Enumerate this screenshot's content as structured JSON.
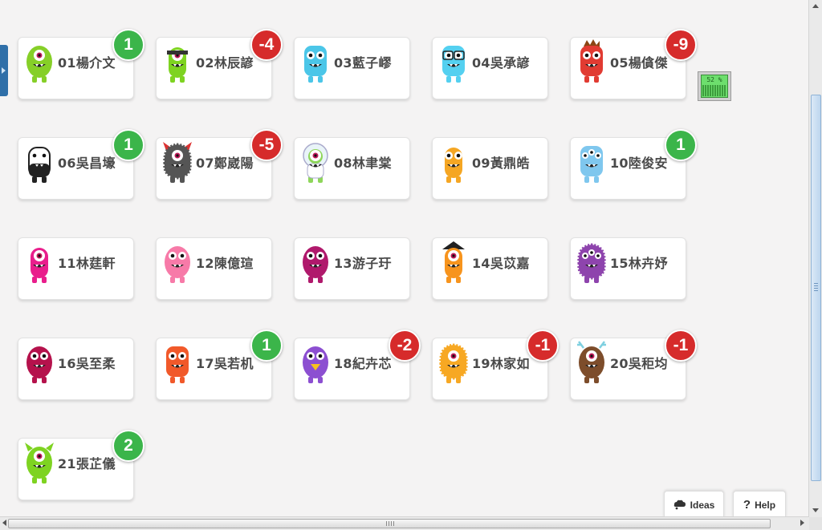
{
  "students": [
    {
      "name": "01楊介文",
      "points": "1",
      "sign": "pos",
      "monster": {
        "type": "round",
        "color": "#86cf28",
        "eyes": 1
      }
    },
    {
      "name": "02林辰諺",
      "points": "-4",
      "sign": "neg",
      "monster": {
        "type": "slim",
        "color": "#7ed321",
        "eyes": 1,
        "band": "#333"
      }
    },
    {
      "name": "03藍子嵺",
      "points": "",
      "sign": "none",
      "monster": {
        "type": "tall",
        "color": "#4bc6e8",
        "eyes": 2
      }
    },
    {
      "name": "04吳承諺",
      "points": "",
      "sign": "none",
      "monster": {
        "type": "tall",
        "color": "#54d0f0",
        "eyes": 2,
        "glasses": true
      }
    },
    {
      "name": "05楊僋傑",
      "points": "-9",
      "sign": "neg",
      "monster": {
        "type": "tall",
        "color": "#e13b32",
        "eyes": 2,
        "hair": "#8b4513"
      }
    },
    {
      "name": "06吳昌壕",
      "points": "1",
      "sign": "pos",
      "monster": {
        "type": "panda",
        "color": "#222",
        "eyes": 2
      }
    },
    {
      "name": "07鄭崴陽",
      "points": "-5",
      "sign": "neg",
      "monster": {
        "type": "furry",
        "color": "#555",
        "eyes": 1,
        "horns": "#d33"
      }
    },
    {
      "name": "08林聿棠",
      "points": "",
      "sign": "none",
      "monster": {
        "type": "astro",
        "color": "#8ed65a",
        "eyes": 1
      }
    },
    {
      "name": "09黃鼎皓",
      "points": "",
      "sign": "none",
      "monster": {
        "type": "slim",
        "color": "#f5a623",
        "eyes": 2
      }
    },
    {
      "name": "10陸俊安",
      "points": "1",
      "sign": "pos",
      "monster": {
        "type": "tall",
        "color": "#7fc7ee",
        "eyes": 3
      }
    },
    {
      "name": "11林莛軒",
      "points": "",
      "sign": "none",
      "monster": {
        "type": "slim",
        "color": "#e91e8c",
        "eyes": 1
      }
    },
    {
      "name": "12陳億瑄",
      "points": "",
      "sign": "none",
      "monster": {
        "type": "round",
        "color": "#f77aa8",
        "eyes": 2
      }
    },
    {
      "name": "13游子玗",
      "points": "",
      "sign": "none",
      "monster": {
        "type": "round",
        "color": "#b0196c",
        "eyes": 2
      }
    },
    {
      "name": "14吳苡嘉",
      "points": "",
      "sign": "none",
      "monster": {
        "type": "slim",
        "color": "#f7941d",
        "eyes": 1,
        "hat": "#222"
      }
    },
    {
      "name": "15林卉妤",
      "points": "",
      "sign": "none",
      "monster": {
        "type": "furry",
        "color": "#8e44ad",
        "eyes": 3
      }
    },
    {
      "name": "16吳至柔",
      "points": "",
      "sign": "none",
      "monster": {
        "type": "round",
        "color": "#b5124c",
        "eyes": 2
      }
    },
    {
      "name": "17吳若机",
      "points": "1",
      "sign": "pos",
      "monster": {
        "type": "tall",
        "color": "#f1592a",
        "eyes": 2
      }
    },
    {
      "name": "18紀卉芯",
      "points": "-2",
      "sign": "neg",
      "monster": {
        "type": "round",
        "color": "#8c4fd1",
        "eyes": 2,
        "beak": "#f7c21d"
      }
    },
    {
      "name": "19林家如",
      "points": "-1",
      "sign": "neg",
      "monster": {
        "type": "furry",
        "color": "#f7a823",
        "eyes": 1
      }
    },
    {
      "name": "20吳秬均",
      "points": "-1",
      "sign": "neg",
      "monster": {
        "type": "round",
        "color": "#7d4d2b",
        "eyes": 1,
        "antlers": "#7fd0e0"
      }
    },
    {
      "name": "21張芷儀",
      "points": "2",
      "sign": "pos",
      "monster": {
        "type": "round",
        "color": "#7ed321",
        "eyes": 1,
        "horns": "#7ed321"
      }
    }
  ],
  "meter": {
    "label": "52 %",
    "level": 0.52
  },
  "buttons": {
    "ideas": "Ideas",
    "help": "Help"
  },
  "icons": {
    "ideas": "lightbulb-cloud-icon",
    "help": "question-mark-icon"
  }
}
